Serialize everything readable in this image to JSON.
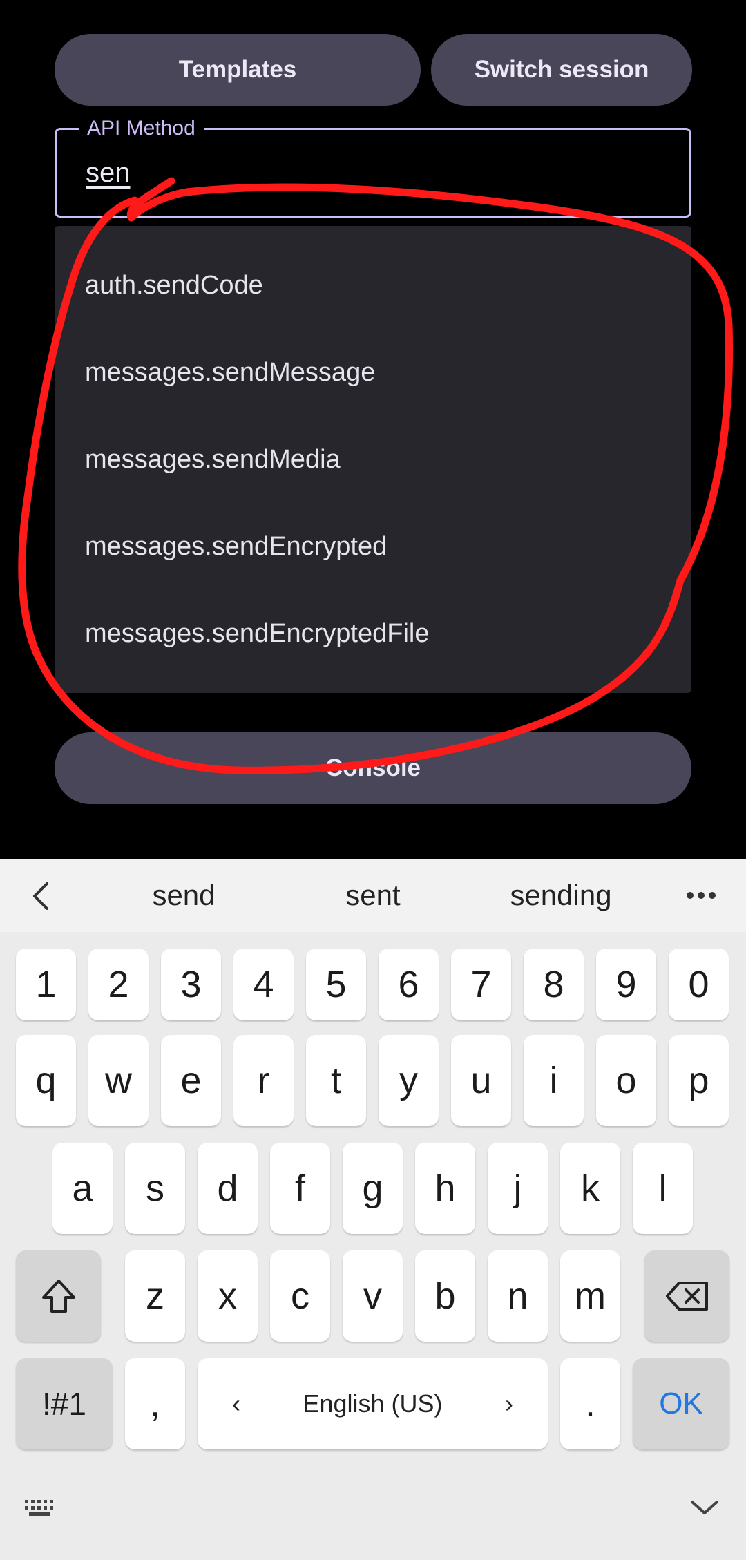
{
  "header": {
    "templates_label": "Templates",
    "switch_session_label": "Switch session"
  },
  "api_method_field": {
    "label": "API Method",
    "value": "sen"
  },
  "dropdown": {
    "items": [
      "auth.sendCode",
      "messages.sendMessage",
      "messages.sendMedia",
      "messages.sendEncrypted",
      "messages.sendEncryptedFile"
    ]
  },
  "console_label": "Console",
  "keyboard": {
    "suggestions": [
      "send",
      "sent",
      "sending"
    ],
    "more_icon": "ellipsis-icon",
    "back_icon": "chevron-left-icon",
    "number_row": [
      "1",
      "2",
      "3",
      "4",
      "5",
      "6",
      "7",
      "8",
      "9",
      "0"
    ],
    "row1": [
      "q",
      "w",
      "e",
      "r",
      "t",
      "y",
      "u",
      "i",
      "o",
      "p"
    ],
    "row2": [
      "a",
      "s",
      "d",
      "f",
      "g",
      "h",
      "j",
      "k",
      "l"
    ],
    "row3": [
      "z",
      "x",
      "c",
      "v",
      "b",
      "n",
      "m"
    ],
    "symbols_label": "!#1",
    "comma_label": ",",
    "space_label": "English (US)",
    "period_label": ".",
    "ok_label": "OK",
    "shift_icon": "shift-icon",
    "backspace_icon": "backspace-icon",
    "keyboard_switch_icon": "keyboard-icon",
    "hide_icon": "chevron-down-icon"
  },
  "colors": {
    "accent": "#cdbdf7",
    "button_bg": "#4a4659",
    "dropdown_bg": "#27262d",
    "annotation": "#ff1a1a",
    "ok_blue": "#2477e3"
  }
}
